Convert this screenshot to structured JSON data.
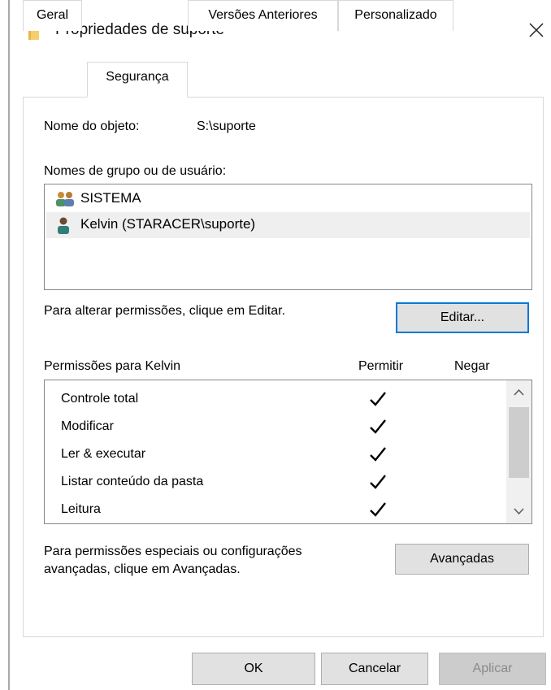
{
  "window": {
    "title": "Propriedades de suporte",
    "close_icon": "close-icon",
    "folder_icon": "folder-icon"
  },
  "tabs": [
    {
      "label": "Geral",
      "selected": false
    },
    {
      "label": "Segurança",
      "selected": true
    },
    {
      "label": "Versões Anteriores",
      "selected": false
    },
    {
      "label": "Personalizado",
      "selected": false
    }
  ],
  "object": {
    "label": "Nome do objeto:",
    "value": "S:\\suporte"
  },
  "groups": {
    "label": "Nomes de grupo ou de usuário:",
    "items": [
      {
        "name": "SISTEMA",
        "icon": "users-group-icon",
        "selected": false
      },
      {
        "name": "Kelvin (STARACER\\suporte)",
        "icon": "user-icon",
        "selected": true
      }
    ]
  },
  "edit": {
    "hint": "Para alterar permissões, clique em Editar.",
    "button_label": "Editar..."
  },
  "permissions": {
    "label": "Permissões para Kelvin",
    "allow_header": "Permitir",
    "deny_header": "Negar",
    "rows": [
      {
        "name": "Controle total",
        "allow": true,
        "deny": false
      },
      {
        "name": "Modificar",
        "allow": true,
        "deny": false
      },
      {
        "name": "Ler & executar",
        "allow": true,
        "deny": false
      },
      {
        "name": "Listar conteúdo da pasta",
        "allow": true,
        "deny": false
      },
      {
        "name": "Leitura",
        "allow": true,
        "deny": false
      }
    ]
  },
  "advanced": {
    "hint_line1": "Para permissões especiais ou configurações",
    "hint_line2": "avançadas, clique em Avançadas.",
    "button_label": "Avançadas"
  },
  "footer": {
    "ok_label": "OK",
    "cancel_label": "Cancelar",
    "apply_label": "Aplicar"
  },
  "colors": {
    "focus_border": "#0078d7",
    "selected_row": "#efefef",
    "button_face": "#e1e1e1",
    "disabled_text": "#8a8a8a"
  }
}
